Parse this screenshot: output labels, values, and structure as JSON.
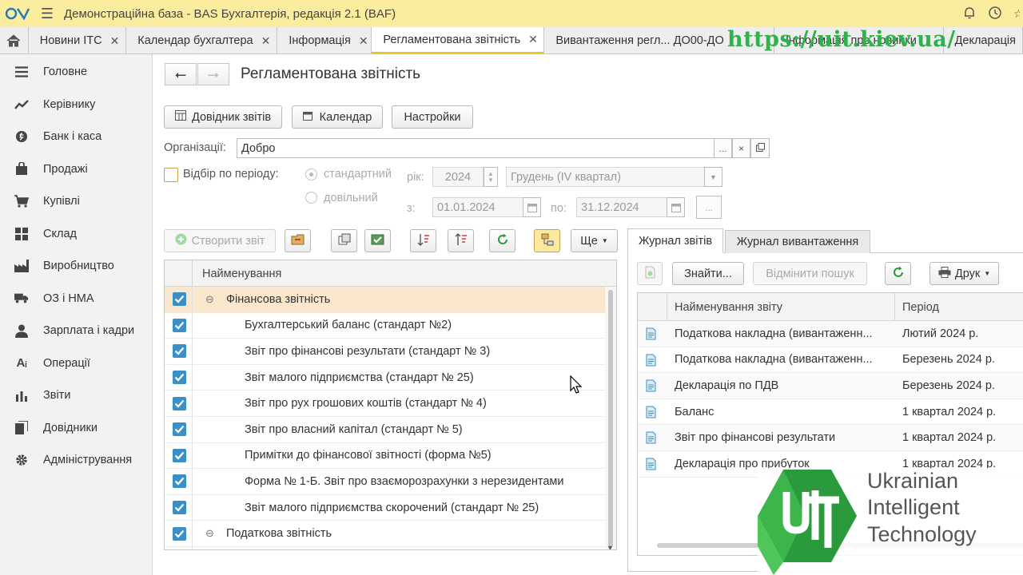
{
  "app": {
    "title": "Демонстраційна база - BAS Бухгалтерія, редакція 2.1  (BAF)"
  },
  "tabs": [
    {
      "label": "Новини ІТС"
    },
    {
      "label": "Календар бухгалтера"
    },
    {
      "label": "Інформація"
    },
    {
      "label": "Регламентована звітність",
      "active": true
    },
    {
      "label": "Вивантаження регл...  ДО00-ДО"
    },
    {
      "label": "Інформація про новинки"
    },
    {
      "label": "Декларація"
    }
  ],
  "watermark": "https://uit.kiev.ua/",
  "sidebar": {
    "items": [
      {
        "label": "Головне",
        "icon": "menu-lines-icon"
      },
      {
        "label": "Керівнику",
        "icon": "trend-chart-icon"
      },
      {
        "label": "Банк і каса",
        "icon": "coin-icon"
      },
      {
        "label": "Продажі",
        "icon": "shopping-bag-icon"
      },
      {
        "label": "Купівлі",
        "icon": "cart-icon"
      },
      {
        "label": "Склад",
        "icon": "warehouse-grid-icon"
      },
      {
        "label": "Виробництво",
        "icon": "factory-icon"
      },
      {
        "label": "ОЗ і НМА",
        "icon": "truck-icon"
      },
      {
        "label": "Зарплата і кадри",
        "icon": "person-icon"
      },
      {
        "label": "Операції",
        "icon": "operations-icon"
      },
      {
        "label": "Звіти",
        "icon": "bar-chart-icon"
      },
      {
        "label": "Довідники",
        "icon": "books-icon"
      },
      {
        "label": "Адміністрування",
        "icon": "gear-icon"
      }
    ]
  },
  "main": {
    "title": "Регламентована звітність",
    "toolbar": {
      "directory": "Довідник звітів",
      "calendar": "Календар",
      "settings": "Настройки"
    },
    "org": {
      "label": "Організації:",
      "value": "Добро",
      "select": "...",
      "clear": "×"
    },
    "period": {
      "filter_label": "Відбір по періоду:",
      "standard": "стандартний",
      "arbitrary": "довільний",
      "year_label": "рік:",
      "year": "2024",
      "month": "Грудень (IV квартал)",
      "from_label": "з:",
      "from": "01.01.2024",
      "to_label": "по:",
      "to": "31.12.2024",
      "more": "..."
    },
    "left_toolbar": {
      "create": "Створити звіт",
      "more": "Ще"
    },
    "tree": {
      "header": "Найменування",
      "rows": [
        {
          "label": "Фінансова звітність",
          "group": true
        },
        {
          "label": "Бухгалтерський баланс (стандарт №2)"
        },
        {
          "label": "Звіт про фінансові результати (стандарт № 3)"
        },
        {
          "label": "Звіт малого підприємства (стандарт № 25)"
        },
        {
          "label": "Звіт про рух грошових коштів (стандарт № 4)"
        },
        {
          "label": "Звіт про власний капітал (стандарт № 5)"
        },
        {
          "label": "Примітки до фінансової звітності (форма №5)"
        },
        {
          "label": "Форма № 1-Б. Звіт про взаєморозрахунки з нерезидентами"
        },
        {
          "label": "Звіт малого підприємства скорочений (стандарт № 25)"
        },
        {
          "label": "Податкова звітність",
          "group": true
        },
        {
          "label": "Декларація про прибуток"
        }
      ]
    },
    "journal": {
      "tab_reports": "Журнал звітів",
      "tab_export": "Журнал вивантаження",
      "find": "Знайти...",
      "cancel_search": "Відмінити пошук",
      "print": "Друк",
      "col_name": "Найменування звіту",
      "col_period": "Період",
      "rows": [
        {
          "name": "Податкова накладна (вивантаженн...",
          "period": "Лютий 2024 р."
        },
        {
          "name": "Податкова накладна (вивантаженн...",
          "period": "Березень 2024 р."
        },
        {
          "name": "Декларація по ПДВ",
          "period": "Березень 2024 р."
        },
        {
          "name": "Баланс",
          "period": "1 квартал 2024 р."
        },
        {
          "name": "Звіт про фінансові результати",
          "period": "1 квартал 2024 р."
        },
        {
          "name": "Декларація про прибуток",
          "period": "1 квартал 2024 р."
        }
      ]
    }
  },
  "brand": {
    "line1": "Ukrainian",
    "line2": "Intelligent",
    "line3": "Technology",
    "logo_letters": "UIT"
  },
  "colors": {
    "accent": "#3a8fc7",
    "titlebar": "#fbed9e",
    "brand_green": "#2db34a"
  }
}
